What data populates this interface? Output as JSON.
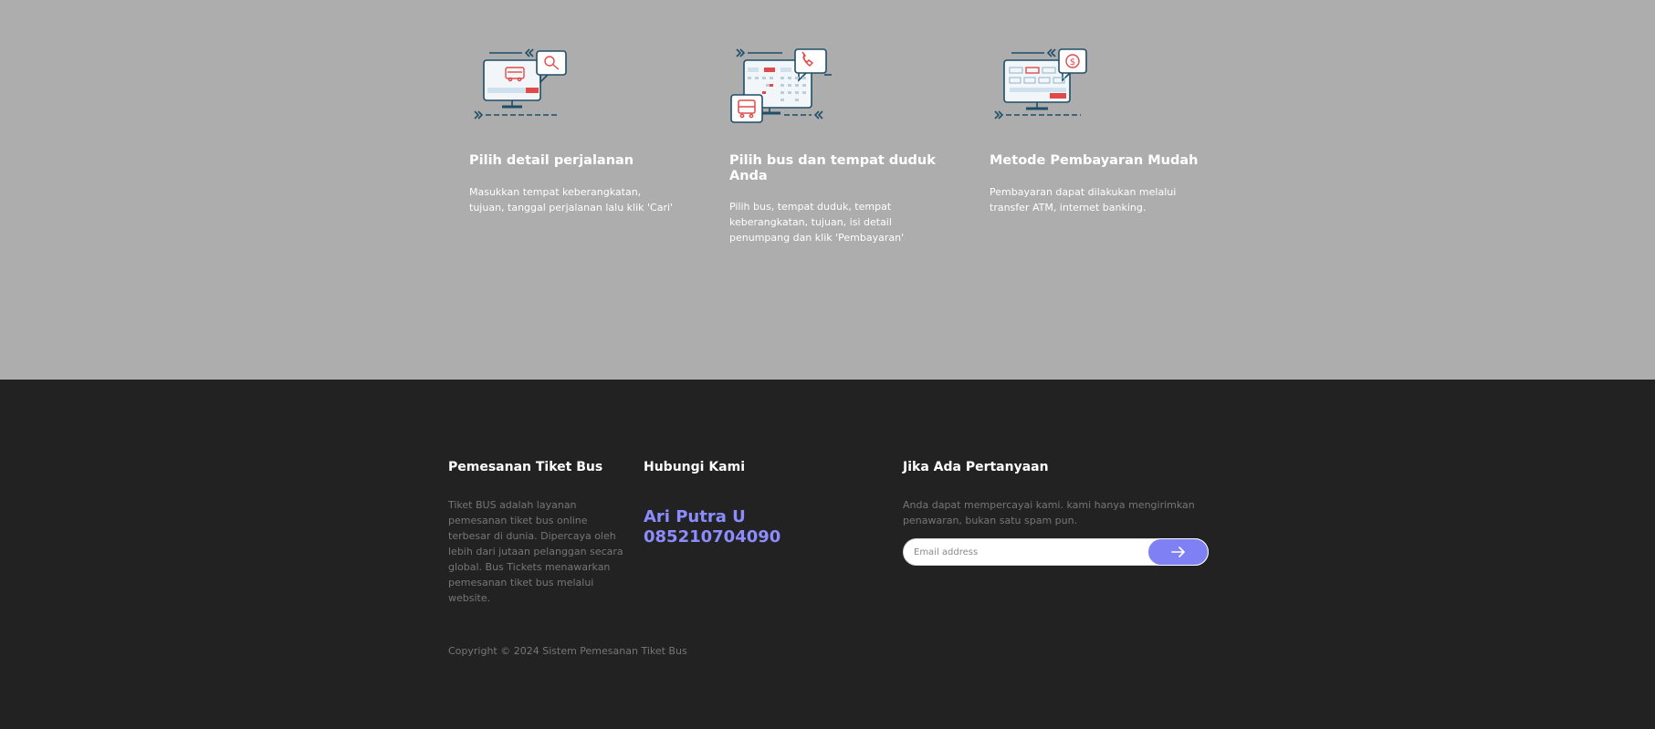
{
  "steps": [
    {
      "icon": "monitor-bus-search-icon",
      "title": "Pilih detail perjalanan",
      "description": "Masukkan tempat keberangkatan, tujuan, tanggal perjalanan lalu klik 'Cari'"
    },
    {
      "icon": "calendar-seat-phone-icon",
      "title": "Pilih bus dan tempat duduk Anda",
      "description": "Pilih bus, tempat duduk, tempat keberangkatan, tujuan, isi detail penumpang dan klik 'Pembayaran'"
    },
    {
      "icon": "monitor-payment-dollar-icon",
      "title": "Metode Pembayaran Mudah",
      "description": "Pembayaran dapat dilakukan melalui transfer ATM, internet banking."
    }
  ],
  "footer": {
    "about": {
      "title": "Pemesanan Tiket Bus",
      "text": "Tiket BUS adalah layanan pemesanan tiket bus online terbesar di dunia. Dipercaya oleh lebih dari jutaan pelanggan secara global. Bus Tickets menawarkan pemesanan tiket bus melalui website."
    },
    "contact": {
      "title": "Hubungi Kami",
      "name": "Ari Putra U",
      "phone": "085210704090"
    },
    "newsletter": {
      "title": "Jika Ada Pertanyaan",
      "text": "Anda dapat mempercayai kami. kami hanya mengirimkan penawaran, bukan satu spam pun.",
      "email_placeholder": "Email address",
      "submit_icon": "arrow-right-icon"
    },
    "copyright": "Copyright © 2024 Sistem Pemesanan Tiket Bus"
  },
  "colors": {
    "steps_background": "#adadad",
    "footer_background": "#222222",
    "accent": "#8080f5",
    "icon_red": "#e04a4a",
    "icon_dark": "#1f4e66"
  }
}
